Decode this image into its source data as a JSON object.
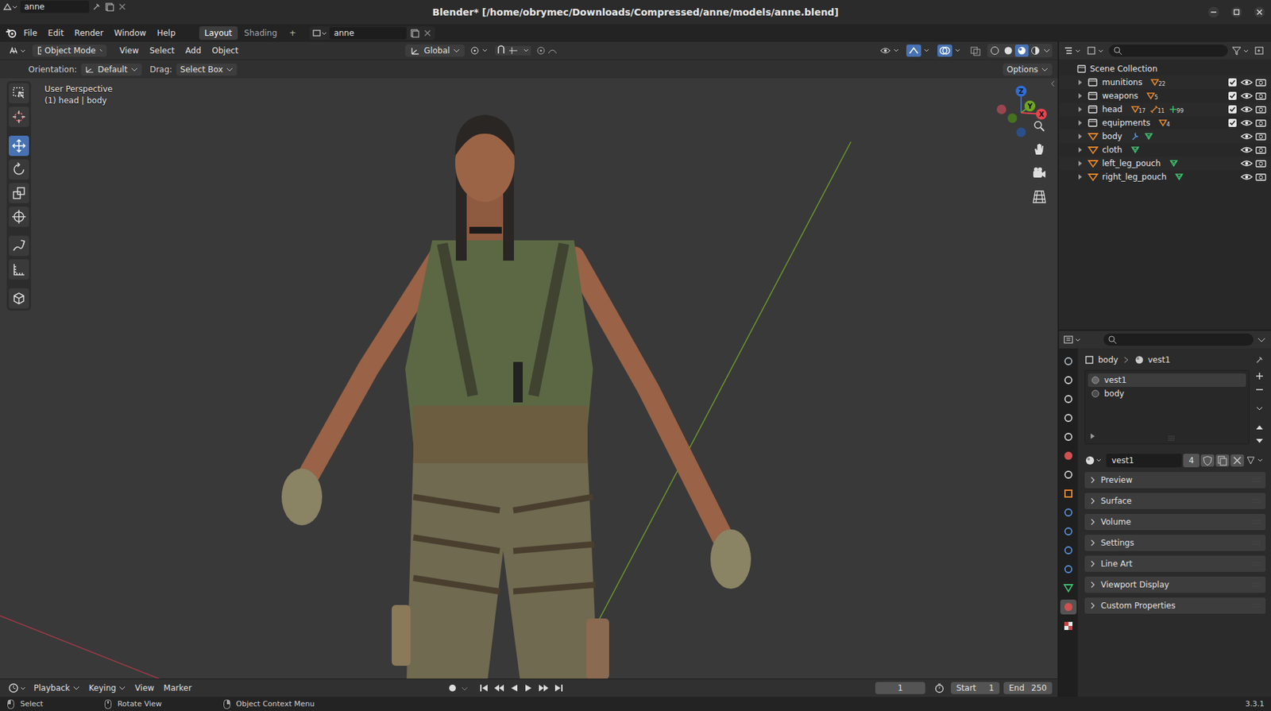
{
  "window": {
    "title": "Blender* [/home/obrymec/Downloads/Compressed/anne/models/anne.blend]"
  },
  "menus": [
    "File",
    "Edit",
    "Render",
    "Window",
    "Help"
  ],
  "workspaces": [
    {
      "label": "Layout",
      "selected": true
    },
    {
      "label": "Shading",
      "selected": false
    }
  ],
  "add_workspace": "+",
  "scene": "anne",
  "view_layer": "anne",
  "viewport": {
    "mode": "Object Mode",
    "menus": [
      "View",
      "Select",
      "Add",
      "Object"
    ],
    "orientation": "Global",
    "shading": [
      {
        "kind": "wireframe",
        "selected": false
      },
      {
        "kind": "solid",
        "selected": false
      },
      {
        "kind": "material",
        "selected": true
      },
      {
        "kind": "rendered",
        "selected": false
      }
    ],
    "tool_settings": {
      "orientation_label": "Orientation:",
      "orientation": "Default",
      "drag_label": "Drag:",
      "drag": "Select Box",
      "options": "Options"
    },
    "overlay": [
      "User Perspective",
      "(1) head | body"
    ],
    "tools": [
      {
        "kind": "select",
        "selected": false
      },
      {
        "kind": "cursor",
        "selected": false
      },
      {
        "kind": "move",
        "selected": true
      },
      {
        "kind": "rotate",
        "selected": false
      },
      {
        "kind": "scale",
        "selected": false
      },
      {
        "kind": "transform",
        "selected": false
      },
      {
        "kind": "annotate",
        "selected": false
      },
      {
        "kind": "measure",
        "selected": false
      },
      {
        "kind": "add",
        "selected": false
      }
    ],
    "gizmo": {
      "axes": [
        {
          "label": "Z",
          "color": "#2f6fd6"
        },
        {
          "label": "Y",
          "color": "#6ea522"
        },
        {
          "label": "X",
          "color": "#e8434f"
        }
      ],
      "negative_axes": [
        {
          "color": "#9a4650"
        },
        {
          "color": "#44731f"
        },
        {
          "color": "#2c4f8a"
        }
      ]
    }
  },
  "outliner": {
    "root": "Scene Collection",
    "items": [
      {
        "name": "munitions",
        "kind": "collection",
        "badges": [
          {
            "kind": "mesh",
            "count": "22"
          }
        ],
        "checked": true,
        "visible": true,
        "renderable": true
      },
      {
        "name": "weapons",
        "kind": "collection",
        "badges": [
          {
            "kind": "mesh",
            "count": "5"
          }
        ],
        "checked": true,
        "visible": true,
        "renderable": true
      },
      {
        "name": "head",
        "kind": "collection",
        "badges": [
          {
            "kind": "mesh",
            "count": "17"
          },
          {
            "kind": "bone",
            "count": "11"
          },
          {
            "kind": "extra",
            "count": "99"
          }
        ],
        "checked": true,
        "visible": true,
        "renderable": true
      },
      {
        "name": "equipments",
        "kind": "collection",
        "badges": [
          {
            "kind": "mesh",
            "count": "4"
          }
        ],
        "checked": true,
        "visible": true,
        "renderable": true
      },
      {
        "name": "body",
        "kind": "object",
        "badges": [
          {
            "kind": "modifier",
            "count": ""
          },
          {
            "kind": "meshdata",
            "count": ""
          }
        ],
        "checked": false,
        "visible": true,
        "renderable": true
      },
      {
        "name": "cloth",
        "kind": "object",
        "badges": [
          {
            "kind": "meshdata",
            "count": ""
          }
        ],
        "checked": false,
        "visible": true,
        "renderable": true
      },
      {
        "name": "left_leg_pouch",
        "kind": "object",
        "badges": [
          {
            "kind": "meshdata",
            "count": ""
          }
        ],
        "checked": false,
        "visible": true,
        "renderable": true
      },
      {
        "name": "right_leg_pouch",
        "kind": "object",
        "badges": [
          {
            "kind": "meshdata",
            "count": ""
          }
        ],
        "checked": false,
        "visible": true,
        "renderable": true
      }
    ]
  },
  "properties": {
    "tabs": [
      {
        "kind": "tool",
        "selected": false
      },
      {
        "kind": "render",
        "selected": false
      },
      {
        "kind": "output",
        "selected": false
      },
      {
        "kind": "viewlayer",
        "selected": false
      },
      {
        "kind": "scene",
        "selected": false
      },
      {
        "kind": "world",
        "selected": false
      },
      {
        "kind": "collection",
        "selected": false
      },
      {
        "kind": "object",
        "selected": false
      },
      {
        "kind": "modifier",
        "selected": false
      },
      {
        "kind": "particles",
        "selected": false
      },
      {
        "kind": "physics",
        "selected": false
      },
      {
        "kind": "constraints",
        "selected": false
      },
      {
        "kind": "data",
        "selected": false
      },
      {
        "kind": "material",
        "selected": true
      },
      {
        "kind": "texture",
        "selected": false
      }
    ],
    "breadcrumb": [
      "body",
      "vest1"
    ],
    "slots": [
      {
        "name": "vest1",
        "selected": true
      },
      {
        "name": "body",
        "selected": false
      }
    ],
    "material": {
      "name": "vest1",
      "users": "4"
    },
    "panels": [
      "Preview",
      "Surface",
      "Volume",
      "Settings",
      "Line Art",
      "Viewport Display",
      "Custom Properties"
    ]
  },
  "timeline": {
    "menus": [
      {
        "label": "Playback",
        "dropdown": true
      },
      {
        "label": "Keying",
        "dropdown": true
      },
      {
        "label": "View",
        "dropdown": false
      },
      {
        "label": "Marker",
        "dropdown": false
      }
    ],
    "frame": "1",
    "start_label": "Start",
    "start": "1",
    "end_label": "End",
    "end": "250"
  },
  "status_bar": {
    "hints": [
      "Select",
      "Rotate View",
      "Object Context Menu"
    ],
    "version": "3.3.1"
  }
}
